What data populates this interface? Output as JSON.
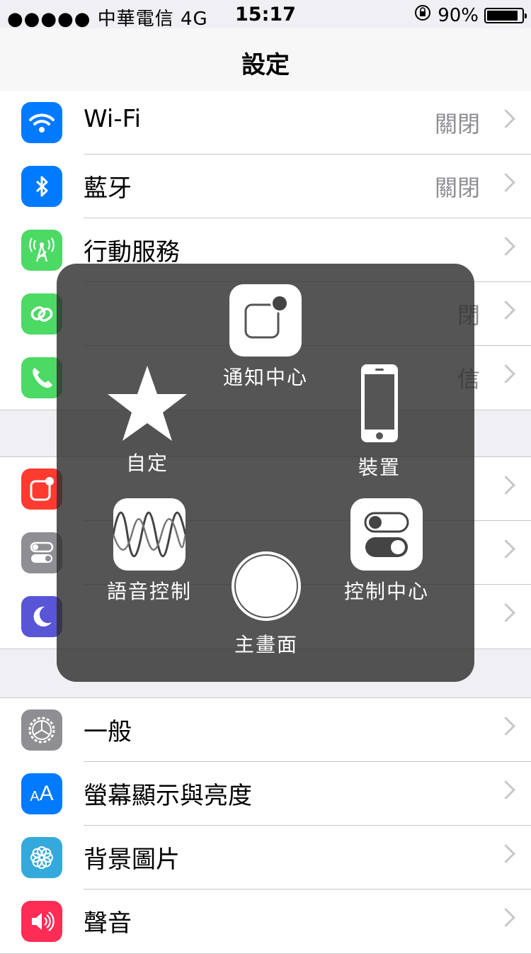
{
  "status_bar": {
    "carrier": "●●●●● 中華電信  4G",
    "time": "15:17",
    "battery_percent": "90%",
    "battery_level": 0.9
  },
  "nav": {
    "title": "設定"
  },
  "group1": [
    {
      "label": "Wi-Fi",
      "value": "關閉",
      "icon": "wifi-icon",
      "color": "#007aff"
    },
    {
      "label": "藍牙",
      "value": "關閉",
      "icon": "bluetooth-icon",
      "color": "#007aff"
    },
    {
      "label": "行動服務",
      "value": "",
      "icon": "cellular-icon",
      "color": "#4cd964"
    },
    {
      "label": "",
      "value": "閉",
      "icon": "hotspot-icon",
      "color": "#4cd964"
    },
    {
      "label": "",
      "value": "信",
      "icon": "phone-icon",
      "color": "#4cd964"
    }
  ],
  "group2": [
    {
      "label": "",
      "icon": "notifications-icon",
      "color": "#ff3b30"
    },
    {
      "label": "",
      "icon": "control-center-icon",
      "color": "#8e8e93"
    },
    {
      "label": "",
      "icon": "do-not-disturb-icon",
      "color": "#5856d6"
    }
  ],
  "group3": [
    {
      "label": "一般",
      "icon": "gear-icon",
      "color": "#8e8e93"
    },
    {
      "label": "螢幕顯示與亮度",
      "icon": "display-icon",
      "color": "#007aff"
    },
    {
      "label": "背景圖片",
      "icon": "wallpaper-icon",
      "color": "#34aadc"
    },
    {
      "label": "聲音",
      "icon": "sound-icon",
      "color": "#ff2d55"
    }
  ],
  "assistive_touch": {
    "notification_center": "通知中心",
    "custom": "自定",
    "device": "裝置",
    "siri": "語音控制",
    "control_center": "控制中心",
    "home": "主畫面"
  }
}
